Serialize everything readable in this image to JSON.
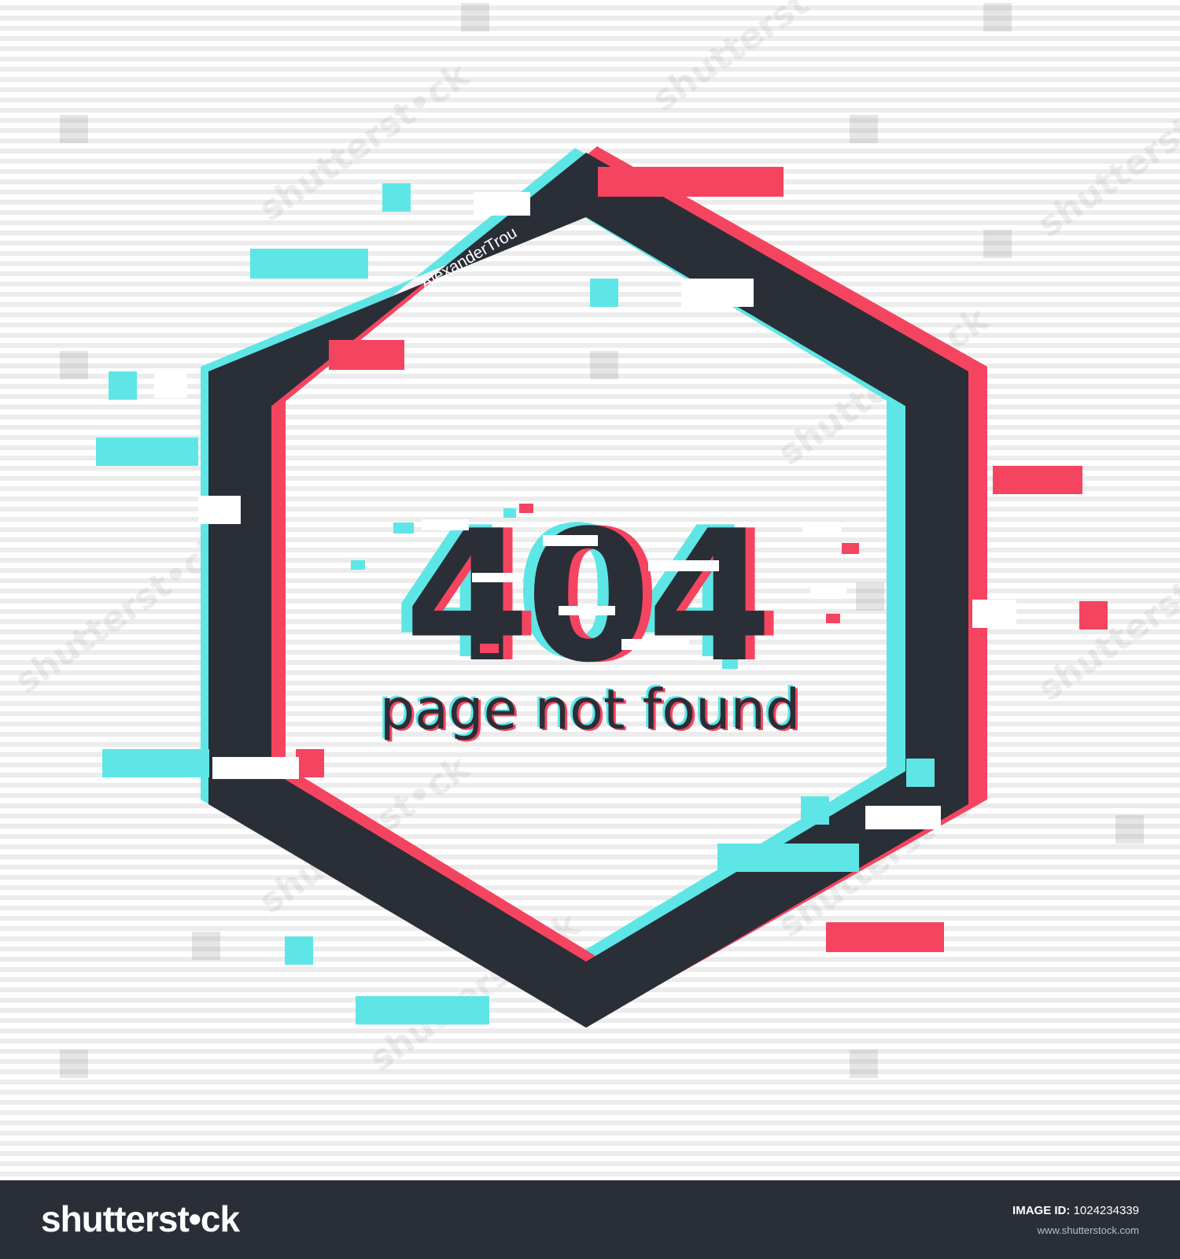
{
  "illustration": {
    "error_code": "404",
    "message": "page not found",
    "author_tag": "AlexanderTrou",
    "colors": {
      "frame": "#2a2e37",
      "cyan": "#5ee6e6",
      "red": "#f5445f",
      "background": "#ffffff",
      "stripe": "#ececec"
    }
  },
  "watermarks": {
    "text": "shutterst•ck",
    "author": "AlexanderTrou"
  },
  "footer": {
    "logo": "shutterst•ck",
    "image_id_label": "IMAGE ID:",
    "image_id": "1024234339",
    "site": "www.shutterstock.com"
  }
}
